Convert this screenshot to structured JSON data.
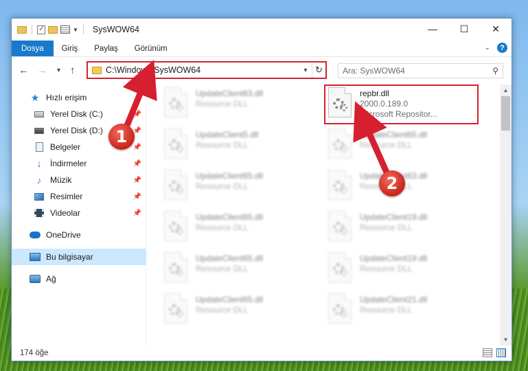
{
  "window": {
    "title": "SysWOW64",
    "minimize": "—",
    "maximize": "☐",
    "close": "✕"
  },
  "ribbon": {
    "tabs": [
      {
        "label": "Dosya",
        "active": true
      },
      {
        "label": "Giriş"
      },
      {
        "label": "Paylaş"
      },
      {
        "label": "Görünüm"
      }
    ],
    "collapse_icon": "chevron-down-icon",
    "help": "?"
  },
  "address": {
    "path": "C:\\Windows\\SysWOW64",
    "refresh_icon": "refresh-icon"
  },
  "search": {
    "placeholder": "Ara: SysWOW64"
  },
  "nav_pane": {
    "quick_access": "Hızlı erişim",
    "items": [
      {
        "label": "Yerel Disk (C:)",
        "icon": "disk-icon",
        "pinned": true
      },
      {
        "label": "Yerel Disk (D:)",
        "icon": "disk-icon",
        "pinned": true
      },
      {
        "label": "Belgeler",
        "icon": "documents-icon",
        "pinned": true
      },
      {
        "label": "İndirmeler",
        "icon": "download-icon",
        "pinned": true
      },
      {
        "label": "Müzik",
        "icon": "music-icon",
        "pinned": true
      },
      {
        "label": "Resimler",
        "icon": "pictures-icon",
        "pinned": true
      },
      {
        "label": "Videolar",
        "icon": "videos-icon",
        "pinned": true
      }
    ],
    "onedrive": "OneDrive",
    "this_pc": "Bu bilgisayar",
    "network": "Ağ"
  },
  "files": {
    "left_column": [
      {
        "name": "UpdateClient63.dll",
        "type": "Resource DLL"
      },
      {
        "name": "UpdateClient5.dll",
        "type": "Resource DLL"
      },
      {
        "name": "UpdateClient65.dll",
        "type": "Resource DLL"
      },
      {
        "name": "UpdateClient65.dll",
        "type": "Resource DLL"
      },
      {
        "name": "UpdateClient65.dll",
        "type": "Resource DLL"
      },
      {
        "name": "UpdateClient65.dll",
        "type": "Resource DLL"
      }
    ],
    "highlighted": {
      "name": "repbr.dll",
      "version": "2000.0.189.0",
      "company": "Microsoft Repositor..."
    },
    "right_column": [
      {
        "name": "UpdateClient65.dll",
        "type": "Resource DLL"
      },
      {
        "name": "UpdateClient63.dll",
        "type": "Resource DLL"
      },
      {
        "name": "UpdateClient19.dll",
        "type": "Resource DLL"
      },
      {
        "name": "UpdateClient19.dll",
        "type": "Resource DLL"
      },
      {
        "name": "UpdateClient21.dll",
        "type": "Resource DLL"
      }
    ]
  },
  "status": {
    "count": "174 öğe"
  },
  "annotations": {
    "step1": "1",
    "step2": "2",
    "color": "#d6202f"
  }
}
